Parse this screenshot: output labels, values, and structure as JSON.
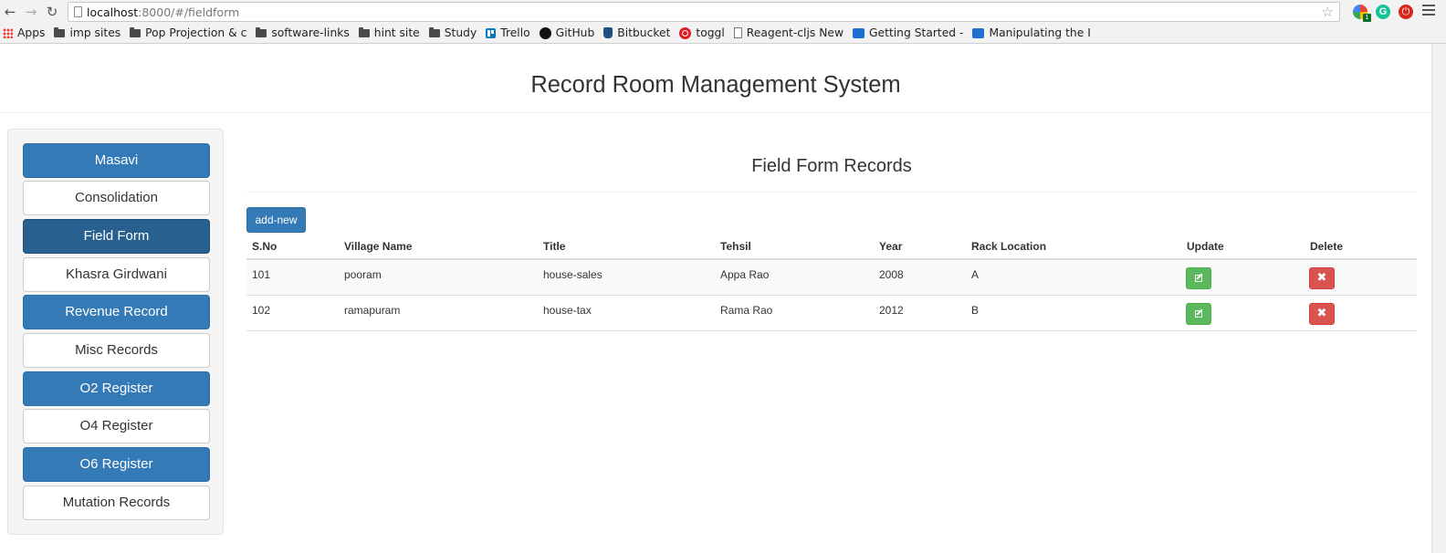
{
  "browser": {
    "url_host": "localhost",
    "url_path": ":8000/#/fieldform",
    "bookmarks": [
      {
        "label": "Apps",
        "icon": "apps-icon"
      },
      {
        "label": "imp sites",
        "icon": "folder-icon"
      },
      {
        "label": "Pop Projection & c",
        "icon": "folder-icon"
      },
      {
        "label": "software-links",
        "icon": "folder-icon"
      },
      {
        "label": "hint site",
        "icon": "folder-icon"
      },
      {
        "label": "Study",
        "icon": "folder-icon"
      },
      {
        "label": "Trello",
        "icon": "trello-icon"
      },
      {
        "label": "GitHub",
        "icon": "github-icon"
      },
      {
        "label": "Bitbucket",
        "icon": "bitbucket-icon"
      },
      {
        "label": "toggl",
        "icon": "toggl-icon"
      },
      {
        "label": "Reagent-cljs New",
        "icon": "page-icon"
      },
      {
        "label": "Getting Started -",
        "icon": "confluence-icon"
      },
      {
        "label": "Manipulating the I",
        "icon": "confluence-icon"
      }
    ],
    "extension_badge": "1",
    "grammarly_letter": "G"
  },
  "app": {
    "title": "Record Room Management System"
  },
  "sidebar": {
    "items": [
      {
        "label": "Masavi"
      },
      {
        "label": "Consolidation"
      },
      {
        "label": "Field Form"
      },
      {
        "label": "Khasra Girdwani"
      },
      {
        "label": "Revenue Record"
      },
      {
        "label": "Misc Records"
      },
      {
        "label": "O2 Register"
      },
      {
        "label": "O4 Register"
      },
      {
        "label": "O6 Register"
      },
      {
        "label": "Mutation Records"
      }
    ]
  },
  "main": {
    "heading": "Field Form Records",
    "add_label": "add-new",
    "columns": [
      "S.No",
      "Village Name",
      "Title",
      "Tehsil",
      "Year",
      "Rack Location",
      "Update",
      "Delete"
    ],
    "rows": [
      [
        "101",
        "pooram",
        "house-sales",
        "Appa Rao",
        "2008",
        "A"
      ],
      [
        "102",
        "ramapuram",
        "house-tax",
        "Rama Rao",
        "2012",
        "B"
      ]
    ]
  },
  "colors": {
    "primary": "#337ab7",
    "active": "#286090",
    "success": "#5cb85c",
    "danger": "#d9534f"
  }
}
